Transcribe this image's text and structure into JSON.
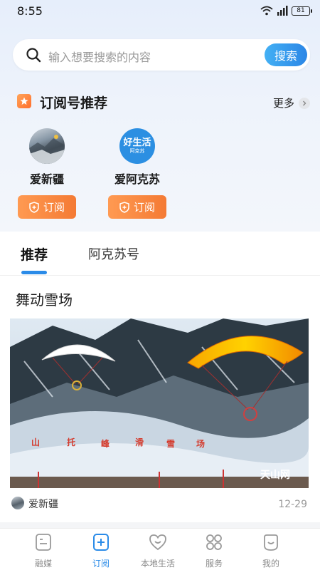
{
  "status_bar": {
    "time": "8:55",
    "battery": "81",
    "network": "4G"
  },
  "search": {
    "placeholder": "输入想要搜索的内容",
    "button_label": "搜索"
  },
  "subscriptions": {
    "title": "订阅号推荐",
    "more_label": "更多",
    "accounts": [
      {
        "name": "爱新疆",
        "button_label": "订阅"
      },
      {
        "name": "爱阿克苏",
        "button_label": "订阅",
        "avatar_text": "好生活",
        "avatar_subtext": "阿克苏"
      }
    ]
  },
  "tabs": [
    {
      "label": "推荐",
      "active": true
    },
    {
      "label": "阿克苏号",
      "active": false
    }
  ],
  "article": {
    "title": "舞动雪场",
    "image_sign": [
      "山",
      "托",
      "峰",
      "滑",
      "雪",
      "场"
    ],
    "watermark": "天山网",
    "source": "爱新疆",
    "date": "12-29"
  },
  "bottom_nav": [
    {
      "label": "融媒",
      "icon": "media-icon",
      "active": false
    },
    {
      "label": "订阅",
      "icon": "subscribe-plus-icon",
      "active": true
    },
    {
      "label": "本地生活",
      "icon": "heart-smile-icon",
      "active": false
    },
    {
      "label": "服务",
      "icon": "services-grid-icon",
      "active": false
    },
    {
      "label": "我的",
      "icon": "profile-smile-icon",
      "active": false
    }
  ],
  "colors": {
    "accent": "#2a8be8",
    "orange": "#f47a34"
  }
}
